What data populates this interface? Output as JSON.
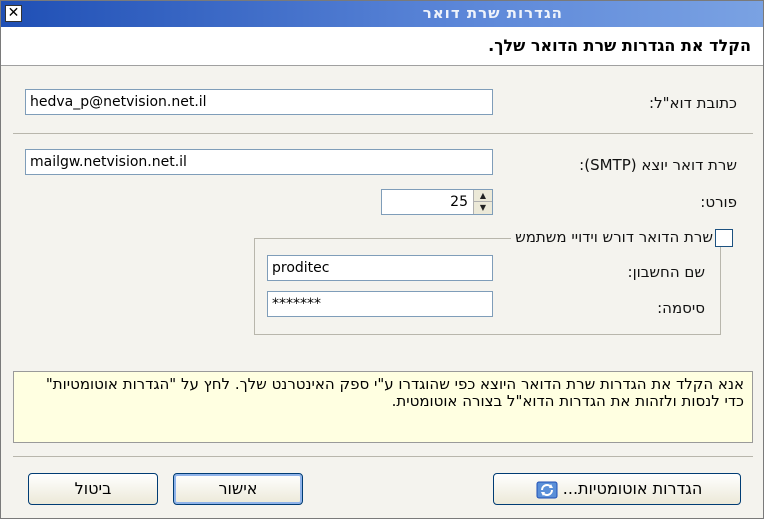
{
  "window": {
    "title": "הגדרות שרת דואר",
    "close_glyph": "✕"
  },
  "header": {
    "instruction": "הקלד את הגדרות שרת הדואר שלך."
  },
  "email": {
    "label": "כתובת דוא\"ל:",
    "value": "hedva_p@netvision.net.il"
  },
  "smtp": {
    "label": "שרת דואר יוצא (SMTP):",
    "value": "mailgw.netvision.net.il"
  },
  "port": {
    "label": "פורט:",
    "value": "25"
  },
  "auth": {
    "checkbox_label": "שרת הדואר דורש וידויי משתמש",
    "checked": false,
    "account_label": "שם החשבון:",
    "account_value": "proditec",
    "password_label": "סיסמה:",
    "password_value": "*******"
  },
  "info": {
    "text": "אנא הקלד את הגדרות שרת הדואר היוצא כפי שהוגדרו ע\"י ספק האינטרנט שלך. לחץ על \"הגדרות אוטומטיות\" כדי לנסות ולזהות את הגדרות הדוא\"ל בצורה אוטומטית."
  },
  "buttons": {
    "auto_label": "הגדרות אוטומטיות...",
    "ok_label": "אישור",
    "cancel_label": "ביטול"
  }
}
